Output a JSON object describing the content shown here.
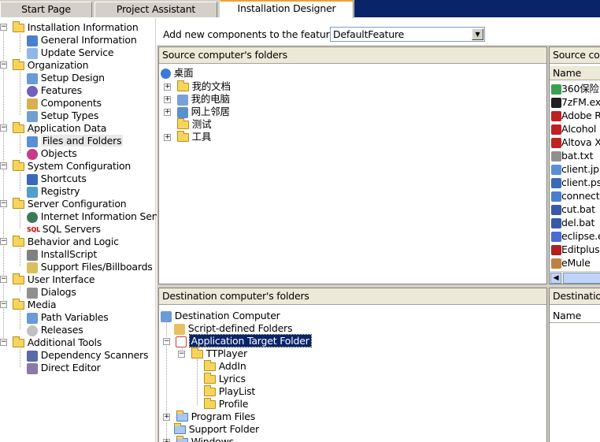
{
  "tabs": [
    {
      "label": "Start Page"
    },
    {
      "label": "Project Assistant"
    },
    {
      "label": "Installation Designer"
    }
  ],
  "nav": {
    "sections": [
      {
        "label": "Installation Information",
        "items": [
          "General Information",
          "Update Service"
        ]
      },
      {
        "label": "Organization",
        "items": [
          "Setup Design",
          "Features",
          "Components",
          "Setup Types"
        ]
      },
      {
        "label": "Application Data",
        "items": [
          "Files and Folders",
          "Objects"
        ]
      },
      {
        "label": "System Configuration",
        "items": [
          "Shortcuts",
          "Registry"
        ]
      },
      {
        "label": "Server Configuration",
        "items": [
          "Internet Information Serv",
          "SQL Servers"
        ]
      },
      {
        "label": "Behavior and Logic",
        "items": [
          "InstallScript",
          "Support Files/Billboards"
        ]
      },
      {
        "label": "User Interface",
        "items": [
          "Dialogs"
        ]
      },
      {
        "label": "Media",
        "items": [
          "Path Variables",
          "Releases"
        ]
      },
      {
        "label": "Additional Tools",
        "items": [
          "Dependency Scanners",
          "Direct Editor"
        ]
      }
    ],
    "selected": "Files and Folders"
  },
  "feature": {
    "label": "Add new components to the feature",
    "value": "DefaultFeature"
  },
  "source_folders": {
    "header": "Source computer's folders",
    "root": "桌面",
    "items": [
      "我的文档",
      "我的电脑",
      "网上邻居",
      "测试",
      "工具"
    ]
  },
  "source_files": {
    "header": "Source con",
    "column": "Name",
    "items": [
      "360保险",
      "7zFM.ex",
      "Adobe R",
      "Alcohol",
      "Altova X",
      "bat.txt",
      "client.jp",
      "client.ps",
      "connect",
      "cut.bat",
      "del.bat",
      "eclipse.e",
      "Editplus",
      "eMule"
    ]
  },
  "dest_folders": {
    "header": "Destination computer's folders",
    "root": "Destination Computer",
    "script_defined": "Script-defined Folders",
    "app_target": "Application Target Folder",
    "ttplayer": "TTPlayer",
    "ttplayer_children": [
      "AddIn",
      "Lyrics",
      "PlayList",
      "Profile"
    ],
    "program_files": "Program Files",
    "support_folder": "Support Folder",
    "windows": "Windows"
  },
  "dest_files": {
    "header": "Destination",
    "column": "Name"
  },
  "colors": {
    "tab_active_accent": "#f0a030",
    "title_navy": "#0a246a",
    "panel_header": "#ece9d8",
    "folder_yellow": "#f7d45e"
  }
}
